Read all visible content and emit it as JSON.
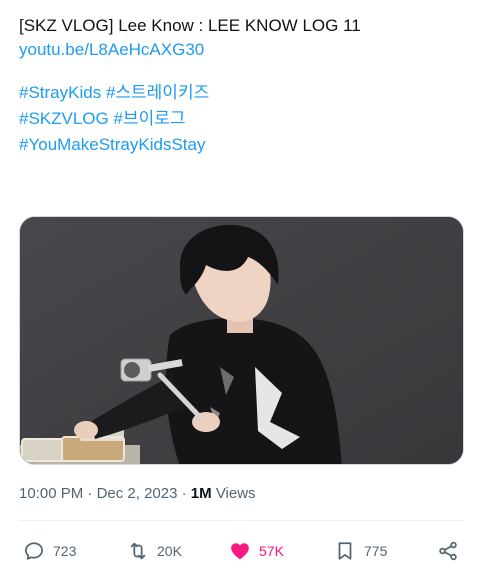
{
  "tweet": {
    "title": "[SKZ VLOG] Lee Know : LEE KNOW LOG 11",
    "link": "youtu.be/L8AeHcAXG30",
    "hashtags": [
      [
        "#StrayKids",
        "#스트레이키즈"
      ],
      [
        "#SKZVLOG",
        "#브이로그"
      ],
      [
        "#YouMakeStrayKidsStay"
      ]
    ]
  },
  "meta": {
    "time": "10:00 PM",
    "separator": "·",
    "date": "Dec 2, 2023",
    "views_count": "1M",
    "views_label": "Views"
  },
  "actions": {
    "reply_count": "723",
    "retweet_count": "20K",
    "like_count": "57K",
    "bookmark_count": "775"
  },
  "colors": {
    "link": "#1d9bf0",
    "like": "#f91880",
    "muted": "#536471"
  },
  "icons": [
    "reply-icon",
    "retweet-icon",
    "like-icon",
    "bookmark-icon",
    "share-icon"
  ]
}
